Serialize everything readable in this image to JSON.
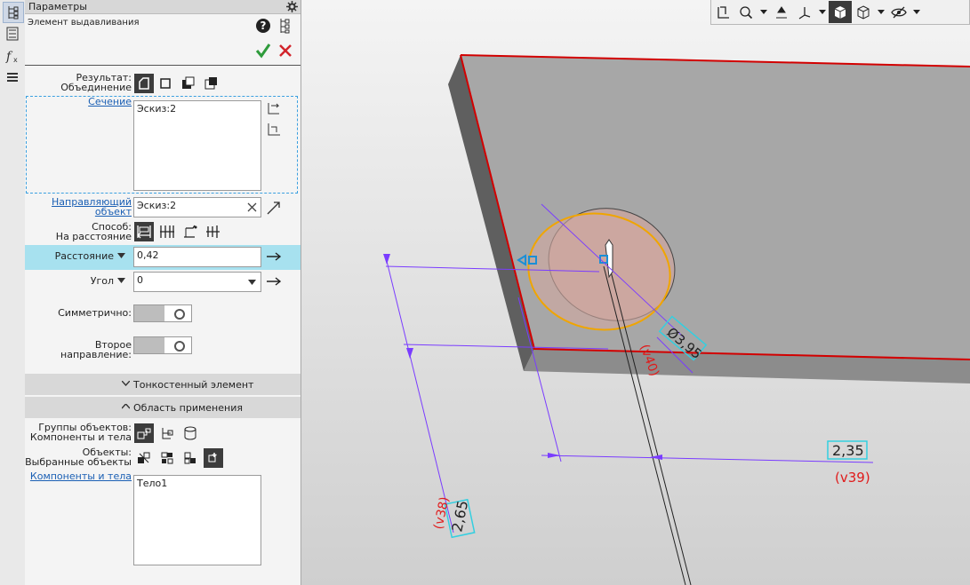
{
  "panel": {
    "title": "Параметры",
    "subtitle": "Элемент выдавливания",
    "result_label": "Результат:",
    "result_value": "Объединение",
    "section_link": "Сечение",
    "section_list": "Эскиз:2",
    "guide_link_1": "Направляющий",
    "guide_link_2": "объект",
    "guide_value": "Эскиз:2",
    "method_label": "Способ:",
    "method_value": "На расстояние",
    "distance_label": "Расстояние",
    "distance_value": "0,42",
    "angle_label": "Угол",
    "angle_value": "0",
    "symmetric_label": "Симметрично:",
    "second_dir_label": "Второе направление:",
    "thin_wall_section": "Тонкостенный элемент",
    "scope_section": "Область применения",
    "groups_label": "Группы объектов:",
    "groups_value": "Компоненты и тела",
    "objects_label": "Объекты:",
    "objects_value": "Выбранные объекты",
    "components_link": "Компоненты и тела",
    "components_list": "Тело1"
  },
  "icons": {
    "help": "help-icon",
    "tree": "tree-icon",
    "ok": "checkmark-icon",
    "cancel": "close-icon"
  },
  "colors": {
    "highlight_row": "#a7e1ef",
    "ok_green": "#2e9b3b",
    "cancel_red": "#d2232a",
    "edge_red": "#d20000",
    "circle_orange": "#f0a500",
    "dim_violet": "#7a3cff"
  },
  "viewport": {
    "dim_diameter": "Ø3,95",
    "dim_diameter_var": "(v40)",
    "dim_horizontal": "2,35",
    "dim_horizontal_var": "(v39)",
    "dim_vertical": "2,65",
    "dim_vertical_var": "(v38)"
  }
}
